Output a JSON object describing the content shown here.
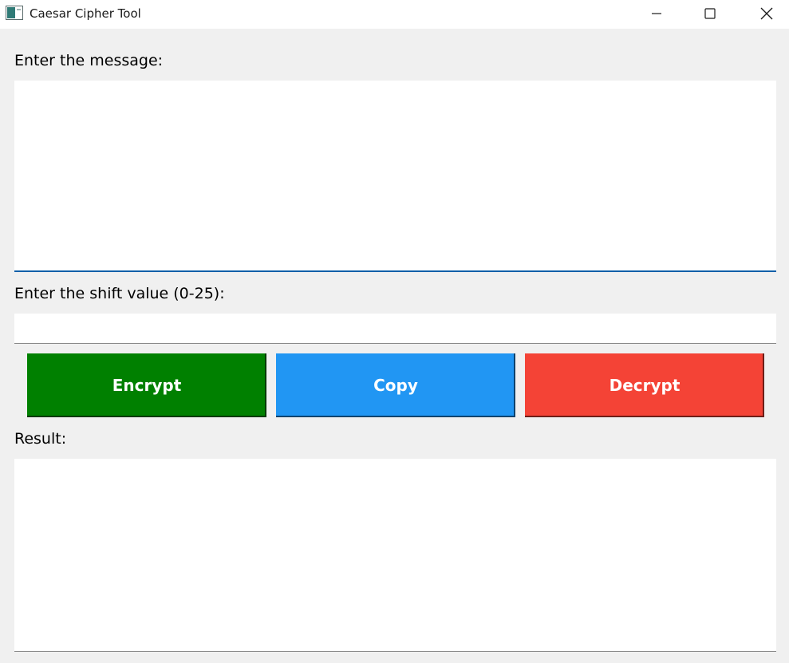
{
  "window": {
    "title": "Caesar Cipher Tool"
  },
  "icons": {
    "app": "app-window-icon",
    "minimize": "minimize-icon",
    "maximize": "maximize-icon",
    "close": "close-icon"
  },
  "form": {
    "message_label": "Enter the message:",
    "message_value": "",
    "shift_label": "Enter the shift value (0-25):",
    "shift_value": "",
    "result_label": "Result:",
    "result_value": ""
  },
  "buttons": {
    "encrypt": {
      "label": "Encrypt",
      "color": "#008000"
    },
    "copy": {
      "label": "Copy",
      "color": "#2196f3"
    },
    "decrypt": {
      "label": "Decrypt",
      "color": "#f44336"
    }
  },
  "colors": {
    "background": "#f0f0f0",
    "focus_underline": "#0a5fa8"
  }
}
